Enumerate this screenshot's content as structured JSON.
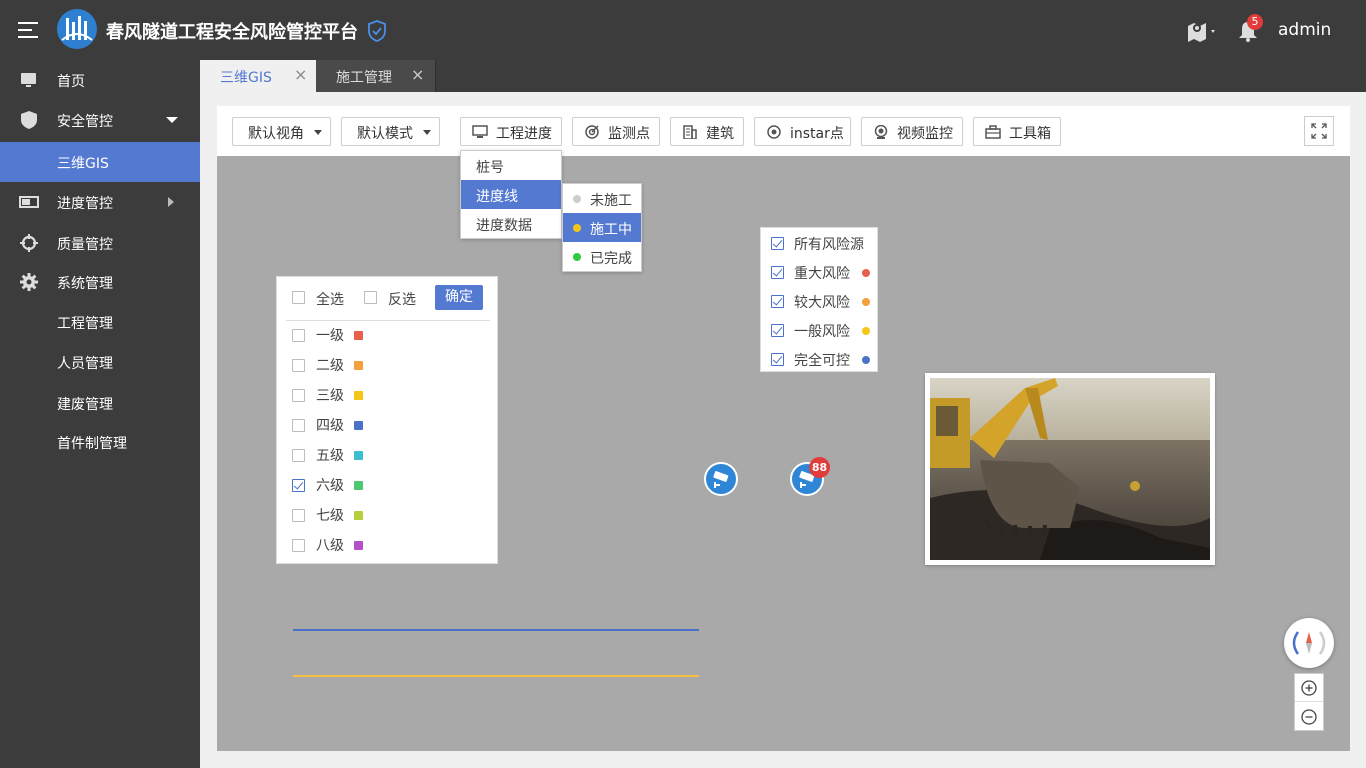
{
  "header": {
    "app_title": "春风隧道工程安全风险管控平台",
    "user": "admin",
    "notification_count": "5"
  },
  "sidebar": {
    "items": [
      {
        "label": "首页",
        "icon": "monitor-icon"
      },
      {
        "label": "安全管控",
        "icon": "shield-icon",
        "expanded": true
      },
      {
        "label": "三维GIS",
        "active": true
      },
      {
        "label": "进度管控",
        "icon": "progress-icon"
      },
      {
        "label": "质量管控",
        "icon": "crosshair-icon"
      },
      {
        "label": "系统管理",
        "icon": "gear-icon"
      },
      {
        "label": "工程管理"
      },
      {
        "label": "人员管理"
      },
      {
        "label": "建废管理"
      },
      {
        "label": "首件制管理"
      }
    ]
  },
  "tabs": [
    {
      "label": "三维GIS",
      "active": true
    },
    {
      "label": "施工管理",
      "active": false
    }
  ],
  "toolbar": {
    "view_select": "默认视角",
    "mode_select": "默认模式",
    "buttons": [
      "工程进度",
      "监测点",
      "建筑",
      "instar点",
      "视频监控",
      "工具箱"
    ]
  },
  "progress_menu": {
    "items": [
      "桩号",
      "进度线",
      "进度数据"
    ],
    "selected": "进度线",
    "sub_items": [
      {
        "label": "未施工",
        "color": "#cccccc"
      },
      {
        "label": "施工中",
        "color": "#f5c518",
        "selected": true
      },
      {
        "label": "已完成",
        "color": "#2ecc40"
      }
    ]
  },
  "level_filter": {
    "select_all": "全选",
    "invert": "反选",
    "confirm": "确定",
    "levels": [
      {
        "label": "一级",
        "color": "#e8604c",
        "checked": false
      },
      {
        "label": "二级",
        "color": "#f5a03a",
        "checked": false
      },
      {
        "label": "三级",
        "color": "#f5c518",
        "checked": false
      },
      {
        "label": "四级",
        "color": "#4a72c8",
        "checked": false
      },
      {
        "label": "五级",
        "color": "#3bbfd0",
        "checked": false
      },
      {
        "label": "六级",
        "color": "#4cc870",
        "checked": true
      },
      {
        "label": "七级",
        "color": "#b7cf3a",
        "checked": false
      },
      {
        "label": "八级",
        "color": "#b44fc8",
        "checked": false
      }
    ]
  },
  "risk_filter": {
    "items": [
      {
        "label": "所有风险源",
        "checked": true,
        "color": ""
      },
      {
        "label": "重大风险",
        "checked": true,
        "color": "#e8604c"
      },
      {
        "label": "较大风险",
        "checked": true,
        "color": "#f5a03a"
      },
      {
        "label": "一般风险",
        "checked": true,
        "color": "#f5c518"
      },
      {
        "label": "完全可控",
        "checked": true,
        "color": "#4a72c8"
      }
    ]
  },
  "map": {
    "camera_cluster_count": "88",
    "line_colors": [
      "#4a72c8",
      "#f5c040"
    ]
  },
  "colors": {
    "accent": "#5479d1",
    "header_bg": "#3c3c3c",
    "map_bg": "#a9a9a9"
  }
}
